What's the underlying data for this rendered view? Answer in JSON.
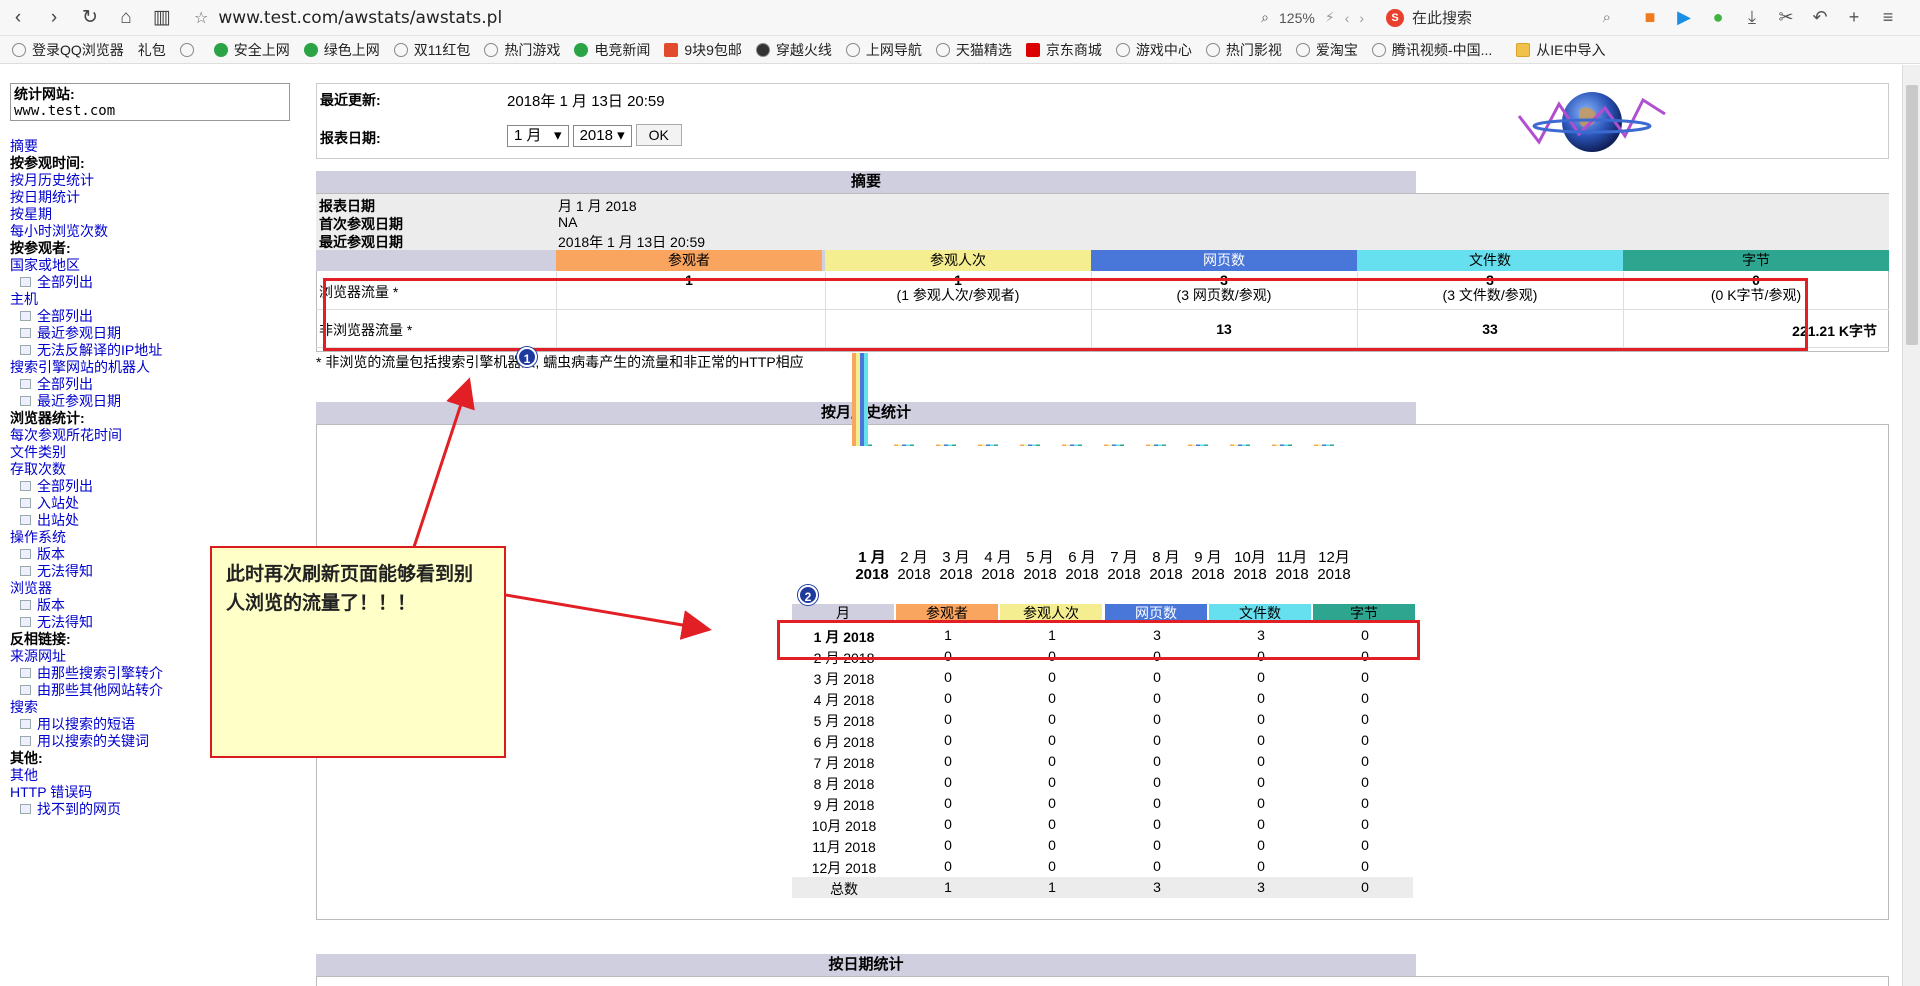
{
  "browser": {
    "url": "www.test.com/awstats/awstats.pl",
    "zoom": "125%",
    "search_placeholder": "在此搜索"
  },
  "bookmarks": [
    "登录QQ浏览器",
    "礼包",
    "安全上网",
    "绿色上网",
    "双11红包",
    "热门游戏",
    "电竞新闻",
    "9块9包邮",
    "穿越火线",
    "上网导航",
    "天猫精选",
    "京东商城",
    "游戏中心",
    "热门影视",
    "爱淘宝",
    "腾讯视频-中国...",
    "从IE中导入"
  ],
  "sidebar": {
    "site_label": "统计网站:",
    "site_value": "www.test.com",
    "items": [
      {
        "t": "link",
        "text": "摘要"
      },
      {
        "t": "head",
        "text": "按参观时间:"
      },
      {
        "t": "link",
        "text": "按月历史统计"
      },
      {
        "t": "link",
        "text": "按日期统计"
      },
      {
        "t": "link",
        "text": "按星期"
      },
      {
        "t": "link",
        "text": "每小时浏览次数"
      },
      {
        "t": "head",
        "text": "按参观者:"
      },
      {
        "t": "link",
        "text": "国家或地区"
      },
      {
        "t": "sub",
        "text": "全部列出"
      },
      {
        "t": "link",
        "text": "主机"
      },
      {
        "t": "sub",
        "text": "全部列出"
      },
      {
        "t": "sub",
        "text": "最近参观日期"
      },
      {
        "t": "sub",
        "text": "无法反解译的IP地址"
      },
      {
        "t": "link",
        "text": "搜索引擎网站的机器人"
      },
      {
        "t": "sub",
        "text": "全部列出"
      },
      {
        "t": "sub",
        "text": "最近参观日期"
      },
      {
        "t": "head",
        "text": "浏览器统计:"
      },
      {
        "t": "link",
        "text": "每次参观所花时间"
      },
      {
        "t": "link",
        "text": "文件类别"
      },
      {
        "t": "link",
        "text": "存取次数"
      },
      {
        "t": "sub",
        "text": "全部列出"
      },
      {
        "t": "sub",
        "text": "入站处"
      },
      {
        "t": "sub",
        "text": "出站处"
      },
      {
        "t": "link",
        "text": "操作系统"
      },
      {
        "t": "sub",
        "text": "版本"
      },
      {
        "t": "sub",
        "text": "无法得知"
      },
      {
        "t": "link",
        "text": "浏览器"
      },
      {
        "t": "sub",
        "text": "版本"
      },
      {
        "t": "sub",
        "text": "无法得知"
      },
      {
        "t": "head",
        "text": "反相链接:"
      },
      {
        "t": "link",
        "text": "来源网址"
      },
      {
        "t": "sub",
        "text": "由那些搜索引擎转介"
      },
      {
        "t": "sub",
        "text": "由那些其他网站转介"
      },
      {
        "t": "link",
        "text": "搜索"
      },
      {
        "t": "sub",
        "text": "用以搜索的短语"
      },
      {
        "t": "sub",
        "text": "用以搜索的关键词"
      },
      {
        "t": "head",
        "text": "其他:"
      },
      {
        "t": "link",
        "text": "其他"
      },
      {
        "t": "link",
        "text": "HTTP 错误码"
      },
      {
        "t": "sub",
        "text": "找不到的网页"
      }
    ]
  },
  "top": {
    "last_update_label": "最近更新:",
    "last_update_value": "2018年 1 月 13日 20:59",
    "report_date_label": "报表日期:",
    "month_select": "1 月",
    "year_select": "2018",
    "ok_label": "OK"
  },
  "summary": {
    "title": "摘要",
    "report_date_label": "报表日期",
    "report_date_value": "月 1 月 2018",
    "first_visit_label": "首次参观日期",
    "first_visit_value": "NA",
    "last_visit_label": "最近参观日期",
    "last_visit_value": "2018年 1 月 13日 20:59",
    "columns": [
      "参观者",
      "参观人次",
      "网页数",
      "文件数",
      "字节"
    ],
    "column_colors": [
      "#f9a45f",
      "#f5ee90",
      "#4976d9",
      "#66e0ef",
      "#2ea58f"
    ],
    "browser_row": {
      "label": "浏览器流量 *",
      "values": [
        "1",
        "1",
        "3",
        "3",
        "0"
      ],
      "subs": [
        "",
        "(1 参观人次/参观者)",
        "(3 网页数/参观)",
        "(3 文件数/参观)",
        "(0 K字节/参观)"
      ]
    },
    "nonbrowser_row": {
      "label": "非浏览器流量 *",
      "values": [
        "",
        "",
        "13",
        "33",
        "221.21 K字节"
      ]
    },
    "note": "* 非浏览的流量包括搜索引擎机器人, 蠕虫病毒产生的流量和非正常的HTTP相应"
  },
  "monthly": {
    "title": "按月历史统计",
    "months": [
      "1 月",
      "2 月",
      "3 月",
      "4 月",
      "5 月",
      "6 月",
      "7 月",
      "8 月",
      "9 月",
      "10月",
      "11月",
      "12月"
    ],
    "year": "2018",
    "table_head": [
      "月",
      "参观者",
      "参观人次",
      "网页数",
      "文件数",
      "字节"
    ],
    "rows": [
      [
        "1 月 2018",
        "1",
        "1",
        "3",
        "3",
        "0"
      ],
      [
        "2 月 2018",
        "0",
        "0",
        "0",
        "0",
        "0"
      ],
      [
        "3 月 2018",
        "0",
        "0",
        "0",
        "0",
        "0"
      ],
      [
        "4 月 2018",
        "0",
        "0",
        "0",
        "0",
        "0"
      ],
      [
        "5 月 2018",
        "0",
        "0",
        "0",
        "0",
        "0"
      ],
      [
        "6 月 2018",
        "0",
        "0",
        "0",
        "0",
        "0"
      ],
      [
        "7 月 2018",
        "0",
        "0",
        "0",
        "0",
        "0"
      ],
      [
        "8 月 2018",
        "0",
        "0",
        "0",
        "0",
        "0"
      ],
      [
        "9 月 2018",
        "0",
        "0",
        "0",
        "0",
        "0"
      ],
      [
        "10月 2018",
        "0",
        "0",
        "0",
        "0",
        "0"
      ],
      [
        "11月 2018",
        "0",
        "0",
        "0",
        "0",
        "0"
      ],
      [
        "12月 2018",
        "0",
        "0",
        "0",
        "0",
        "0"
      ]
    ],
    "total": [
      "总数",
      "1",
      "1",
      "3",
      "3",
      "0"
    ]
  },
  "daily": {
    "title": "按日期统计"
  },
  "annotation": {
    "callout_text": "此时再次刷新页面能够看到别人浏览的流量了！！！",
    "badge1": "1",
    "badge2": "2"
  }
}
